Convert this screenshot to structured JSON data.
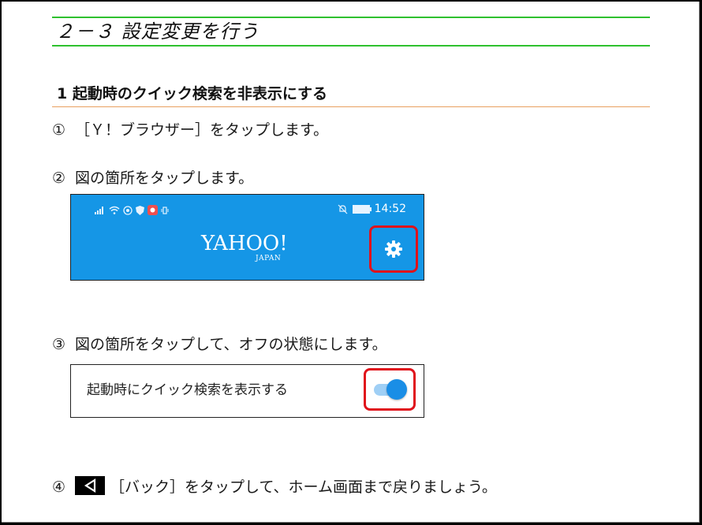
{
  "section": {
    "title": "２－３ 設定変更を行う"
  },
  "subsection": {
    "title": "1 起動時のクイック検索を非表示にする"
  },
  "steps": [
    {
      "num": "①",
      "text": "［Ｙ！ブラウザー］をタップします。"
    },
    {
      "num": "②",
      "text": "図の箇所をタップします。"
    },
    {
      "num": "③",
      "text": "図の箇所をタップして、オフの状態にします。"
    },
    {
      "num": "④",
      "text": "［バック］をタップして、ホーム画面まで戻りましょう。"
    }
  ],
  "app_screenshot": {
    "status_time": "14:52",
    "logo_main": "YAHOO!",
    "logo_sub": "JAPAN",
    "background_color": "#1596e6",
    "highlight_color": "#e0121b",
    "settings_icon": "gear-icon"
  },
  "toggle_screenshot": {
    "label": "起動時にクイック検索を表示する",
    "toggle_state": "on",
    "toggle_color": "#1a8ee6"
  },
  "icons": {
    "back": "back-triangle-icon"
  },
  "colors": {
    "section_rule": "#2fc12f",
    "subsection_rule": "#e8a060"
  }
}
